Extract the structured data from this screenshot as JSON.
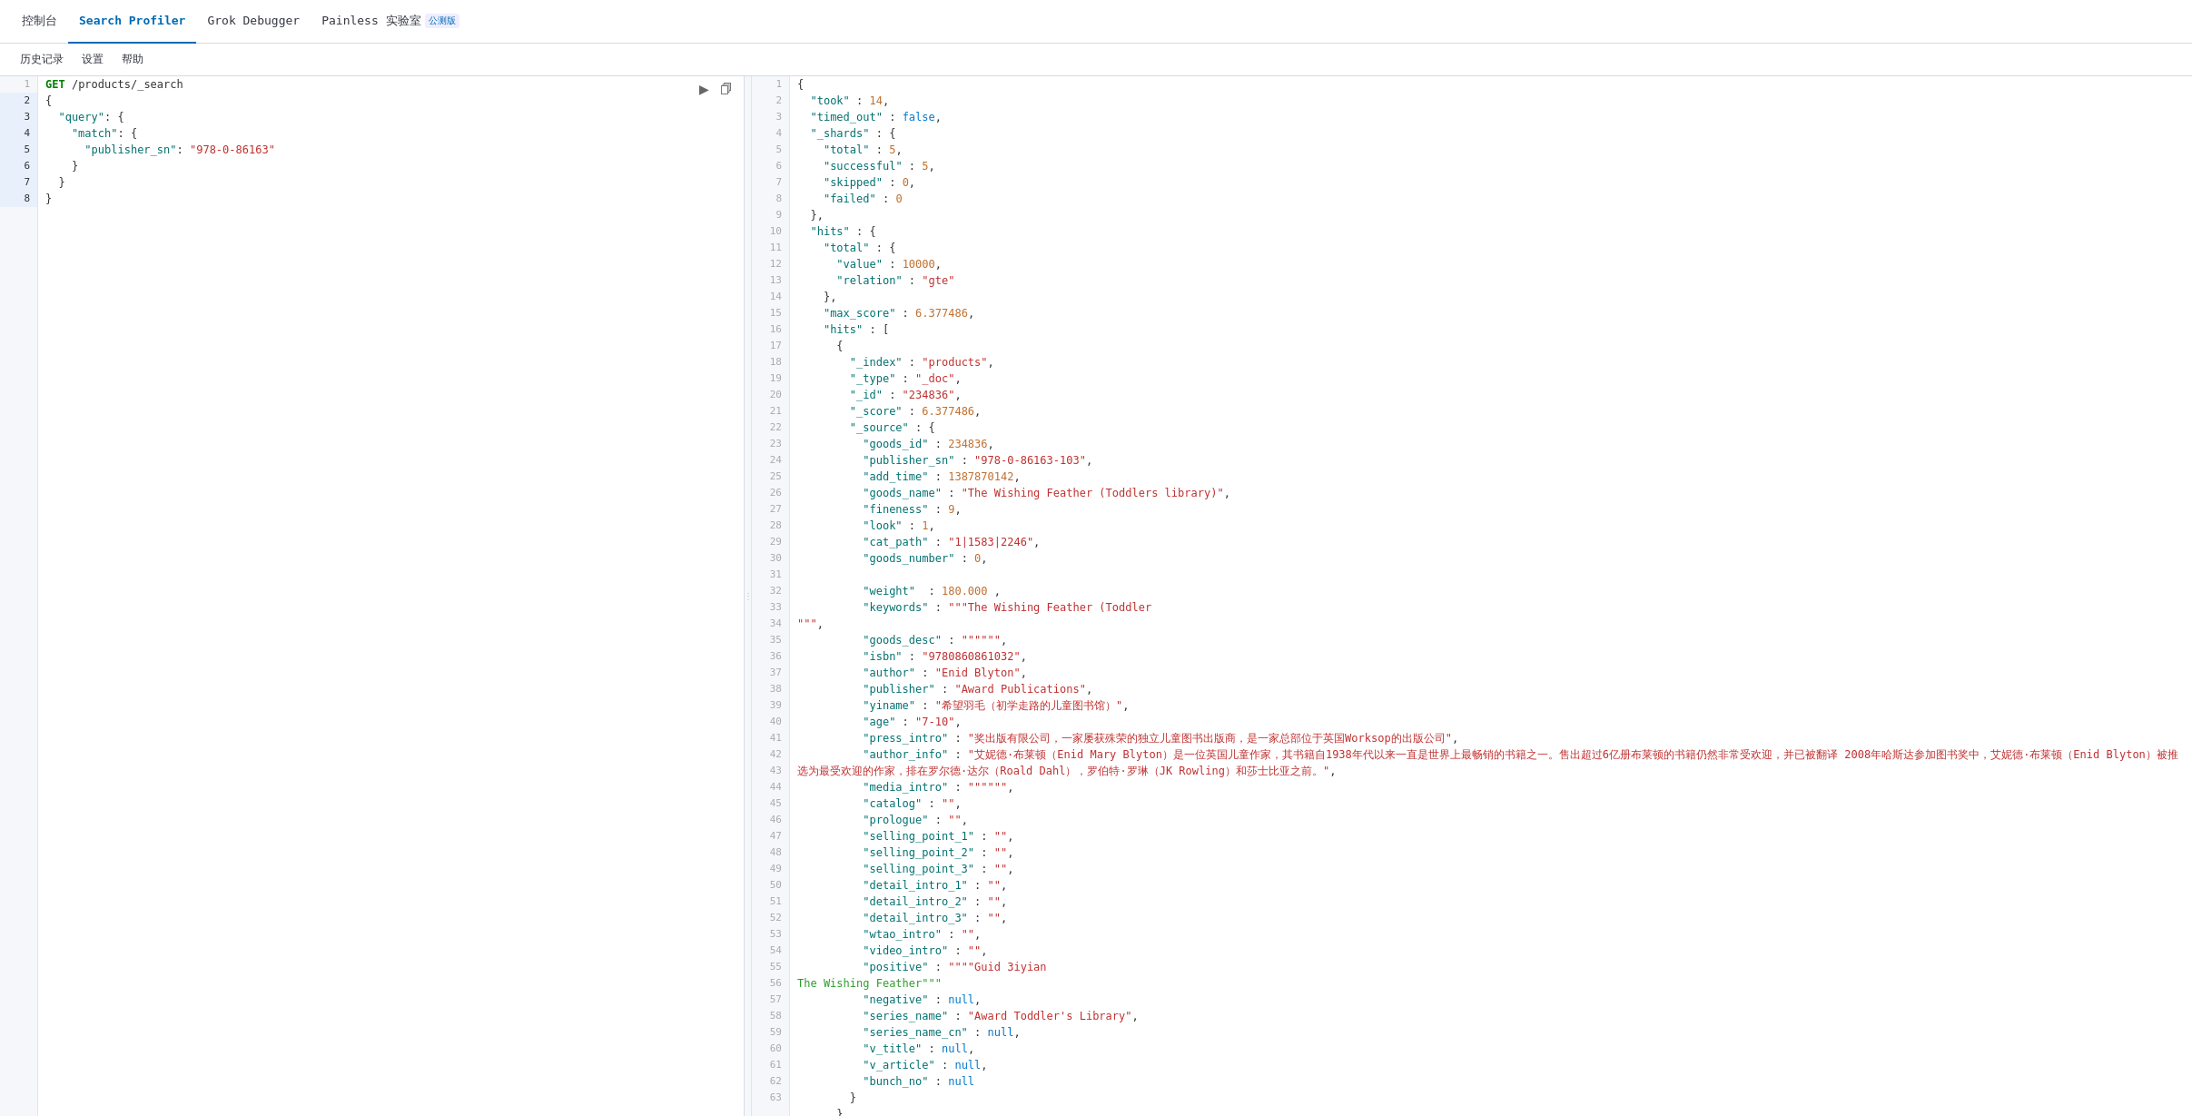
{
  "topNav": {
    "items": [
      {
        "id": "console",
        "label": "控制台",
        "active": false
      },
      {
        "id": "search-profiler",
        "label": "Search Profiler",
        "active": true
      },
      {
        "id": "grok-debugger",
        "label": "Grok Debugger",
        "active": false
      },
      {
        "id": "painless-lab",
        "label": "Painless 实验室",
        "active": false,
        "beta": true,
        "betaLabel": "公测版"
      }
    ]
  },
  "secondNav": {
    "items": [
      {
        "id": "history",
        "label": "历史记录"
      },
      {
        "id": "settings",
        "label": "设置"
      },
      {
        "id": "help",
        "label": "帮助"
      }
    ]
  },
  "editor": {
    "lines": [
      {
        "num": 1,
        "content": "GET /products/_search",
        "type": "method-url"
      },
      {
        "num": 2,
        "content": "{",
        "type": "punct"
      },
      {
        "num": 3,
        "content": "  \"query\": {",
        "type": "code"
      },
      {
        "num": 4,
        "content": "    \"match\": {",
        "type": "code"
      },
      {
        "num": 5,
        "content": "      \"publisher_sn\": \"978-0-86163\"",
        "type": "code"
      },
      {
        "num": 6,
        "content": "    }",
        "type": "code"
      },
      {
        "num": 7,
        "content": "  }",
        "type": "code"
      },
      {
        "num": 8,
        "content": "}",
        "type": "punct"
      }
    ]
  },
  "results": {
    "lines": [
      {
        "num": 1,
        "fold": false,
        "content": "{"
      },
      {
        "num": 2,
        "fold": false,
        "content": "  \"took\" : 14,"
      },
      {
        "num": 3,
        "fold": false,
        "content": "  \"timed_out\" : false,"
      },
      {
        "num": 4,
        "fold": false,
        "content": "  \"_shards\" : {"
      },
      {
        "num": 5,
        "fold": false,
        "content": "    \"total\" : 5,"
      },
      {
        "num": 6,
        "fold": false,
        "content": "    \"successful\" : 5,"
      },
      {
        "num": 7,
        "fold": false,
        "content": "    \"skipped\" : 0,"
      },
      {
        "num": 8,
        "fold": false,
        "content": "    \"failed\" : 0"
      },
      {
        "num": 9,
        "fold": false,
        "content": "  },"
      },
      {
        "num": 10,
        "fold": true,
        "content": "  \"hits\" : {"
      },
      {
        "num": 11,
        "fold": false,
        "content": "    \"total\" : {"
      },
      {
        "num": 12,
        "fold": false,
        "content": "      \"value\" : 10000,"
      },
      {
        "num": 13,
        "fold": false,
        "content": "      \"relation\" : \"gte\""
      },
      {
        "num": 14,
        "fold": false,
        "content": "    },"
      },
      {
        "num": 15,
        "fold": false,
        "content": "    \"max_score\" : 6.377486,"
      },
      {
        "num": 16,
        "fold": false,
        "content": "    \"hits\" : ["
      },
      {
        "num": 17,
        "fold": false,
        "content": "      {"
      },
      {
        "num": 18,
        "fold": false,
        "content": "        \"_index\" : \"products\","
      },
      {
        "num": 19,
        "fold": false,
        "content": "        \"_type\" : \"_doc\","
      },
      {
        "num": 20,
        "fold": false,
        "content": "        \"_id\" : \"234836\","
      },
      {
        "num": 21,
        "fold": false,
        "content": "        \"_score\" : 6.377486,"
      },
      {
        "num": 22,
        "fold": true,
        "content": "        \"_source\" : {"
      },
      {
        "num": 23,
        "fold": false,
        "content": "          \"goods_id\" : 234836,"
      },
      {
        "num": 24,
        "fold": false,
        "content": "          \"publisher_sn\" : \"978-0-86163-103\","
      },
      {
        "num": 25,
        "fold": false,
        "content": "          \"add_time\" : 1387870142,"
      },
      {
        "num": 26,
        "fold": false,
        "content": "          \"goods_name\" : \"The Wishing Feather (Toddlers library)\","
      },
      {
        "num": 27,
        "fold": false,
        "content": "          \"fineness\" : 9,"
      },
      {
        "num": 28,
        "fold": false,
        "content": "          \"look\" : 1,"
      },
      {
        "num": 29,
        "fold": false,
        "content": "          \"cat_path\" : \"1|1583|2246\","
      },
      {
        "num": 30,
        "fold": false,
        "content": "          \"goods_number\" : 0,"
      },
      {
        "num": 31,
        "fold": false,
        "content": ""
      },
      {
        "num": 32,
        "fold": false,
        "content": "          \"weight\"  : 180.000 ,"
      },
      {
        "num": 33,
        "fold": true,
        "content": "          \"keywords\" : \"\"\"The Wishing Feather (Toddler"
      },
      {
        "num": 34,
        "fold": false,
        "content": "\"\"\","
      },
      {
        "num": 35,
        "fold": false,
        "content": "          \"goods_desc\" : \"\"\"\"\"\","
      },
      {
        "num": 36,
        "fold": false,
        "content": "          \"isbn\" : \"9780860861032\","
      },
      {
        "num": 37,
        "fold": false,
        "content": "          \"author\" : \"Enid Blyton\","
      },
      {
        "num": 38,
        "fold": false,
        "content": "          \"publisher\" : \"Award Publications\","
      },
      {
        "num": 39,
        "fold": false,
        "content": "          \"yiname\" : \"希望羽毛（初学走路的儿童图书馆）\","
      },
      {
        "num": 40,
        "fold": false,
        "content": "          \"age\" : \"7-10\","
      },
      {
        "num": 41,
        "fold": false,
        "content": "          \"press_intro\" : \"奖出版有限公司，一家屡获殊荣的独立儿童图书出版商，是一家总部位于英国Worksop的出版公司\","
      },
      {
        "num": 42,
        "fold": false,
        "content": "          \"author_info\" : \"艾妮德·布莱顿（Enid Mary Blyton）是一位英国儿童作家，其书籍自1938年代以来一直是世界上最畅销的书籍之一。售出超过6亿册布莱顿的书籍仍然非常受欢迎，并已被翻译 2008年哈斯达参加图书奖中，艾妮德·布莱顿（Enid Blyton）被推选为最受欢迎的作家，排在罗尔德·达尔（Roald Dahl），罗伯特·罗琳（JK Rowling）和莎士比亚之前。\","
      },
      {
        "num": 43,
        "fold": false,
        "content": "          \"media_intro\" : \"\"\"\"\"\","
      },
      {
        "num": 44,
        "fold": false,
        "content": "          \"catalog\" : \"\","
      },
      {
        "num": 45,
        "fold": false,
        "content": "          \"prologue\" : \"\","
      },
      {
        "num": 46,
        "fold": false,
        "content": "          \"selling_point_1\" : \"\","
      },
      {
        "num": 47,
        "fold": false,
        "content": "          \"selling_point_2\" : \"\","
      },
      {
        "num": 48,
        "fold": false,
        "content": "          \"selling_point_3\" : \"\","
      },
      {
        "num": 49,
        "fold": false,
        "content": "          \"detail_intro_1\" : \"\","
      },
      {
        "num": 50,
        "fold": false,
        "content": "          \"detail_intro_2\" : \"\","
      },
      {
        "num": 51,
        "fold": false,
        "content": "          \"detail_intro_3\" : \"\","
      },
      {
        "num": 52,
        "fold": false,
        "content": "          \"wtao_intro\" : \"\","
      },
      {
        "num": 53,
        "fold": false,
        "content": "          \"video_intro\" : \"\","
      },
      {
        "num": 54,
        "fold": false,
        "content": "          \"positive\" : \"\"\"\"Guid 3iyian"
      },
      {
        "num": 55,
        "fold": false,
        "content": "The Wishing Feather\"\"\""
      },
      {
        "num": 56,
        "fold": false,
        "content": "          \"negative\" : null,"
      },
      {
        "num": 57,
        "fold": false,
        "content": "          \"series_name\" : \"Award Toddler's Library\","
      },
      {
        "num": 58,
        "fold": false,
        "content": "          \"series_name_cn\" : null,"
      },
      {
        "num": 59,
        "fold": false,
        "content": "          \"v_title\" : null,"
      },
      {
        "num": 60,
        "fold": false,
        "content": "          \"v_article\" : null,"
      },
      {
        "num": 61,
        "fold": false,
        "content": "          \"bunch_no\" : null"
      },
      {
        "num": 62,
        "fold": true,
        "content": "        }"
      },
      {
        "num": 63,
        "fold": false,
        "content": "      },"
      }
    ]
  }
}
